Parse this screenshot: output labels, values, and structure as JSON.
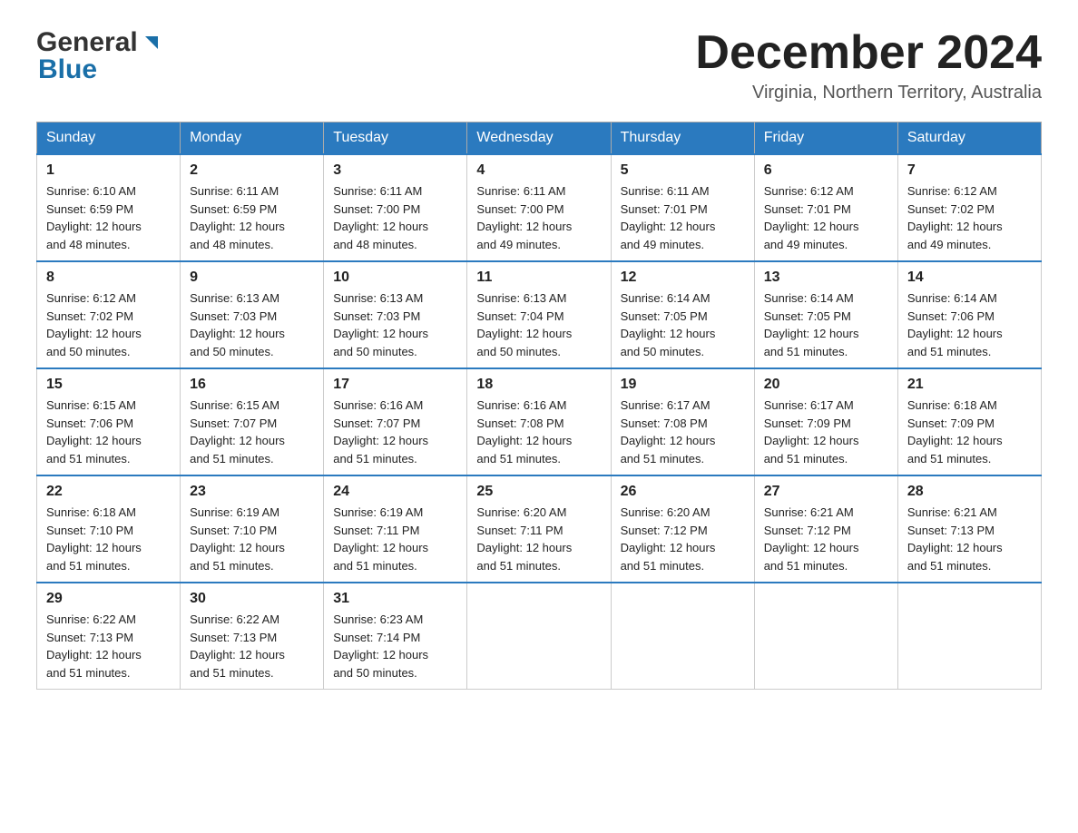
{
  "header": {
    "logo_general": "General",
    "logo_blue": "Blue",
    "month_title": "December 2024",
    "location": "Virginia, Northern Territory, Australia"
  },
  "days_of_week": [
    "Sunday",
    "Monday",
    "Tuesday",
    "Wednesday",
    "Thursday",
    "Friday",
    "Saturday"
  ],
  "weeks": [
    [
      {
        "day": "1",
        "sunrise": "6:10 AM",
        "sunset": "6:59 PM",
        "daylight": "12 hours and 48 minutes."
      },
      {
        "day": "2",
        "sunrise": "6:11 AM",
        "sunset": "6:59 PM",
        "daylight": "12 hours and 48 minutes."
      },
      {
        "day": "3",
        "sunrise": "6:11 AM",
        "sunset": "7:00 PM",
        "daylight": "12 hours and 48 minutes."
      },
      {
        "day": "4",
        "sunrise": "6:11 AM",
        "sunset": "7:00 PM",
        "daylight": "12 hours and 49 minutes."
      },
      {
        "day": "5",
        "sunrise": "6:11 AM",
        "sunset": "7:01 PM",
        "daylight": "12 hours and 49 minutes."
      },
      {
        "day": "6",
        "sunrise": "6:12 AM",
        "sunset": "7:01 PM",
        "daylight": "12 hours and 49 minutes."
      },
      {
        "day": "7",
        "sunrise": "6:12 AM",
        "sunset": "7:02 PM",
        "daylight": "12 hours and 49 minutes."
      }
    ],
    [
      {
        "day": "8",
        "sunrise": "6:12 AM",
        "sunset": "7:02 PM",
        "daylight": "12 hours and 50 minutes."
      },
      {
        "day": "9",
        "sunrise": "6:13 AM",
        "sunset": "7:03 PM",
        "daylight": "12 hours and 50 minutes."
      },
      {
        "day": "10",
        "sunrise": "6:13 AM",
        "sunset": "7:03 PM",
        "daylight": "12 hours and 50 minutes."
      },
      {
        "day": "11",
        "sunrise": "6:13 AM",
        "sunset": "7:04 PM",
        "daylight": "12 hours and 50 minutes."
      },
      {
        "day": "12",
        "sunrise": "6:14 AM",
        "sunset": "7:05 PM",
        "daylight": "12 hours and 50 minutes."
      },
      {
        "day": "13",
        "sunrise": "6:14 AM",
        "sunset": "7:05 PM",
        "daylight": "12 hours and 51 minutes."
      },
      {
        "day": "14",
        "sunrise": "6:14 AM",
        "sunset": "7:06 PM",
        "daylight": "12 hours and 51 minutes."
      }
    ],
    [
      {
        "day": "15",
        "sunrise": "6:15 AM",
        "sunset": "7:06 PM",
        "daylight": "12 hours and 51 minutes."
      },
      {
        "day": "16",
        "sunrise": "6:15 AM",
        "sunset": "7:07 PM",
        "daylight": "12 hours and 51 minutes."
      },
      {
        "day": "17",
        "sunrise": "6:16 AM",
        "sunset": "7:07 PM",
        "daylight": "12 hours and 51 minutes."
      },
      {
        "day": "18",
        "sunrise": "6:16 AM",
        "sunset": "7:08 PM",
        "daylight": "12 hours and 51 minutes."
      },
      {
        "day": "19",
        "sunrise": "6:17 AM",
        "sunset": "7:08 PM",
        "daylight": "12 hours and 51 minutes."
      },
      {
        "day": "20",
        "sunrise": "6:17 AM",
        "sunset": "7:09 PM",
        "daylight": "12 hours and 51 minutes."
      },
      {
        "day": "21",
        "sunrise": "6:18 AM",
        "sunset": "7:09 PM",
        "daylight": "12 hours and 51 minutes."
      }
    ],
    [
      {
        "day": "22",
        "sunrise": "6:18 AM",
        "sunset": "7:10 PM",
        "daylight": "12 hours and 51 minutes."
      },
      {
        "day": "23",
        "sunrise": "6:19 AM",
        "sunset": "7:10 PM",
        "daylight": "12 hours and 51 minutes."
      },
      {
        "day": "24",
        "sunrise": "6:19 AM",
        "sunset": "7:11 PM",
        "daylight": "12 hours and 51 minutes."
      },
      {
        "day": "25",
        "sunrise": "6:20 AM",
        "sunset": "7:11 PM",
        "daylight": "12 hours and 51 minutes."
      },
      {
        "day": "26",
        "sunrise": "6:20 AM",
        "sunset": "7:12 PM",
        "daylight": "12 hours and 51 minutes."
      },
      {
        "day": "27",
        "sunrise": "6:21 AM",
        "sunset": "7:12 PM",
        "daylight": "12 hours and 51 minutes."
      },
      {
        "day": "28",
        "sunrise": "6:21 AM",
        "sunset": "7:13 PM",
        "daylight": "12 hours and 51 minutes."
      }
    ],
    [
      {
        "day": "29",
        "sunrise": "6:22 AM",
        "sunset": "7:13 PM",
        "daylight": "12 hours and 51 minutes."
      },
      {
        "day": "30",
        "sunrise": "6:22 AM",
        "sunset": "7:13 PM",
        "daylight": "12 hours and 51 minutes."
      },
      {
        "day": "31",
        "sunrise": "6:23 AM",
        "sunset": "7:14 PM",
        "daylight": "12 hours and 50 minutes."
      },
      null,
      null,
      null,
      null
    ]
  ],
  "labels": {
    "sunrise": "Sunrise:",
    "sunset": "Sunset:",
    "daylight": "Daylight:"
  }
}
